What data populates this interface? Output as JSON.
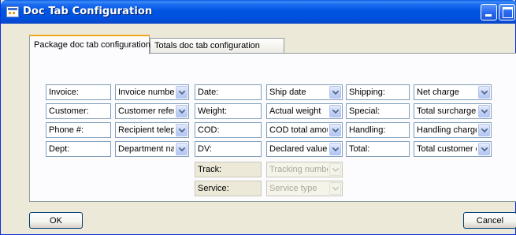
{
  "window": {
    "title": "Doc Tab Configuration",
    "app_icon": "form-window-icon",
    "controls": [
      "minimize-icon",
      "maximize-icon",
      "close-icon"
    ]
  },
  "tabs": [
    {
      "label": "Package doc tab configuration",
      "selected": true
    },
    {
      "label": "Totals doc tab configuration",
      "selected": false
    }
  ],
  "rows": [
    {
      "col1_label": "Invoice:",
      "col1_value": "Invoice number",
      "col2_label": "Date:",
      "col2_value": "Ship date",
      "col3_label": "Shipping:",
      "col3_value": "Net charge"
    },
    {
      "col1_label": "Customer:",
      "col1_value": "Customer referei",
      "col2_label": "Weight:",
      "col2_value": "Actual weight",
      "col3_label": "Special:",
      "col3_value": "Total surcharge"
    },
    {
      "col1_label": "Phone #:",
      "col1_value": "Recipient teleph",
      "col2_label": "COD:",
      "col2_value": "COD total amou",
      "col3_label": "Handling:",
      "col3_value": "Handling charge"
    },
    {
      "col1_label": "Dept:",
      "col1_value": "Department nam",
      "col2_label": "DV:",
      "col2_value": "Declared value",
      "col3_label": "Total:",
      "col3_value": "Total customer c"
    }
  ],
  "disabled_rows": [
    {
      "label": "Track:",
      "value": "Tracking numbe"
    },
    {
      "label": "Service:",
      "value": "Service type"
    }
  ],
  "buttons": {
    "ok": "OK",
    "cancel": "Cancel"
  },
  "colors": {
    "titlebar": "#0054E3",
    "window_bg": "#ECE9D8",
    "field_border": "#7F9DB9",
    "active_tab_accent": "#F1A81C"
  }
}
